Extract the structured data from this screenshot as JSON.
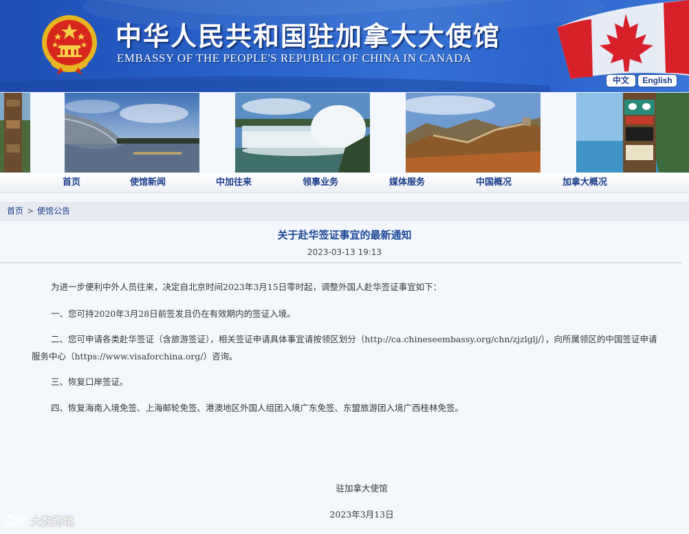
{
  "header": {
    "title_cn": "中华人民共和国驻加拿大大使馆",
    "title_en": "EMBASSY OF THE PEOPLE'S REPUBLIC OF CHINA IN CANADA",
    "lang_cn": "中文",
    "lang_en": "English"
  },
  "nav": {
    "items": [
      "首页",
      "使馆新闻",
      "中加往来",
      "领事业务",
      "媒体服务",
      "中国概况",
      "加拿大概况"
    ]
  },
  "breadcrumb": {
    "home": "首页",
    "sep": ">",
    "current": "使馆公告"
  },
  "article": {
    "title": "关于赴华签证事宜的最新通知",
    "date": "2023-03-13 19:13",
    "paragraphs": [
      "为进一步便利中外人员往来，决定自北京时间2023年3月15日零时起，调整外国人赴华签证事宜如下：",
      "一、您可持2020年3月28日前签发且仍在有效期内的签证入境。",
      "二、您可申请各类赴华签证（含旅游签证），相关签证申请具体事宜请按领区划分（http://ca.chineseembassy.org/chn/zjzlglj/），向所属领区的中国签证申请服务中心（https://www.visaforchina.org/）咨询。",
      "三、恢复口岸签证。",
      "四、恢复海南入境免签、上海邮轮免签、港澳地区外国人组团入境广东免签、东盟旅游团入境广西桂林免签。"
    ],
    "signature": "驻加拿大使馆",
    "signature_date": "2023年3月13日"
  },
  "watermark": {
    "text": "大数跨境"
  },
  "colors": {
    "banner_blue": "#2962c9",
    "link_blue": "#1a3c8c",
    "title_blue": "#1b4797",
    "page_bg": "#f4f8fd"
  }
}
